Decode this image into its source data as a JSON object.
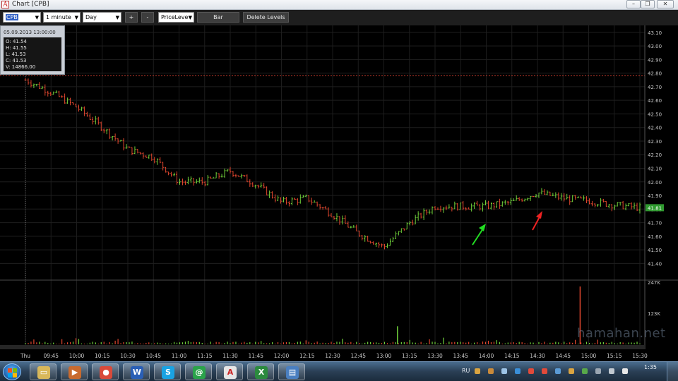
{
  "window": {
    "title": "Chart [CPB]",
    "app_icon": "A",
    "minimize": "–",
    "restore": "❐",
    "close": "✕"
  },
  "toolbar": {
    "symbol": "CPB",
    "interval": "1 minute",
    "period": "Day",
    "zoom_in": "+",
    "zoom_out": "-",
    "study": "PriceLeve",
    "chart_type": "Bar",
    "delete_levels": "Delete Levels"
  },
  "info": {
    "date": "05.09.2013 13:00:00",
    "open": "O: 41.54",
    "high": "H: 41.55",
    "low": "L: 41.53",
    "close": "C: 41.53",
    "volume": "V: 14866.00"
  },
  "last_price": "41.81",
  "watermark": "hamahan.net",
  "chart_data": [
    {
      "type": "ohlc",
      "ylim": [
        41.35,
        43.12
      ],
      "y_ticks": [
        "43.10",
        "43.00",
        "42.90",
        "42.80",
        "42.70",
        "42.60",
        "42.50",
        "42.40",
        "42.30",
        "42.20",
        "42.10",
        "42.00",
        "41.90",
        "41.80",
        "41.70",
        "41.60",
        "41.50",
        "41.40"
      ],
      "x_ticks": [
        "Thu",
        "09:45",
        "10:00",
        "10:15",
        "10:30",
        "10:45",
        "11:00",
        "11:15",
        "11:30",
        "11:45",
        "12:00",
        "12:15",
        "12:30",
        "12:45",
        "13:00",
        "13:15",
        "13:30",
        "13:45",
        "14:00",
        "14:15",
        "14:30",
        "14:45",
        "15:00",
        "15:15",
        "15:30"
      ],
      "level": 42.78,
      "x": [
        "09:30",
        "09:45",
        "10:00",
        "10:15",
        "10:30",
        "10:45",
        "11:00",
        "11:15",
        "11:30",
        "11:45",
        "12:00",
        "12:15",
        "12:30",
        "12:45",
        "13:00",
        "13:15",
        "13:30",
        "13:45",
        "14:00",
        "14:15",
        "14:30",
        "14:45",
        "15:00",
        "15:15",
        "15:30"
      ],
      "close": [
        42.75,
        42.66,
        42.55,
        42.4,
        42.24,
        42.18,
        42.0,
        42.0,
        42.08,
        41.98,
        41.85,
        41.88,
        41.76,
        41.62,
        41.52,
        41.7,
        41.82,
        41.82,
        41.82,
        41.85,
        41.92,
        41.88,
        41.86,
        41.83,
        41.81
      ],
      "bar_count": 220
    },
    {
      "type": "bar",
      "series_label": "volume",
      "y_ticks": [
        "247K",
        "123K"
      ],
      "ylim": [
        0,
        247000
      ],
      "notable_bars": [
        {
          "x": "13:08",
          "value": 72000
        },
        {
          "x": "14:55",
          "value": 230000
        }
      ]
    }
  ],
  "taskbar": {
    "apps": [
      {
        "name": "explorer",
        "glyph": "▭",
        "color": "#d9b85a"
      },
      {
        "name": "media",
        "glyph": "▶",
        "color": "#c86a2e"
      },
      {
        "name": "chrome",
        "glyph": "●",
        "color": "#d94a3a"
      },
      {
        "name": "word",
        "glyph": "W",
        "color": "#2a5fb5"
      },
      {
        "name": "skype",
        "glyph": "S",
        "color": "#1aa3e3"
      },
      {
        "name": "mail-agent",
        "glyph": "@",
        "color": "#2aa34a"
      },
      {
        "name": "trading-app",
        "glyph": "A",
        "color": "#e6e6e6"
      },
      {
        "name": "excel",
        "glyph": "X",
        "color": "#2b8a3e"
      },
      {
        "name": "notes",
        "glyph": "▤",
        "color": "#4a7fc0"
      }
    ],
    "language": "RU",
    "clock_time": "1:35"
  }
}
